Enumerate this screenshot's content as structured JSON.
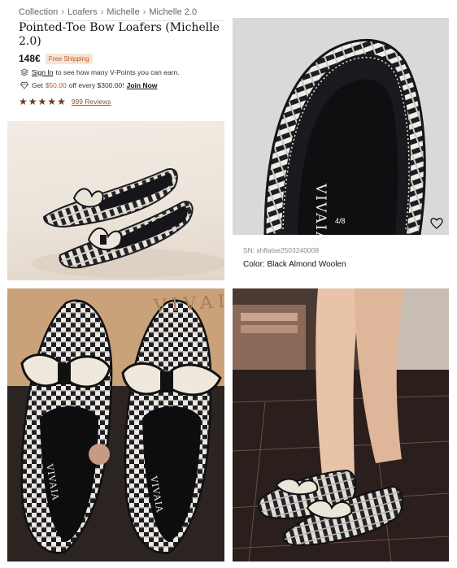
{
  "breadcrumb": {
    "items": [
      "Collection",
      "Loafers",
      "Michelle",
      "Michelle 2.0"
    ],
    "separator": "›"
  },
  "product": {
    "title": "Pointed-Toe Bow Loafers (Michelle 2.0)",
    "price": "148€",
    "shipping_badge": "Free Shipping",
    "signin": {
      "link": "Sign In",
      "text": "to see how many V-Points you can earn."
    },
    "offer": {
      "get": "Get",
      "amount": "$50.00",
      "rest": "off every $300.00!",
      "join": "Join Now"
    },
    "rating": {
      "stars": 5,
      "reviews": "999 Reviews"
    },
    "sn": "SN: shflatse2503240008",
    "color": "Color: Black Almond Woolen"
  },
  "gallery": {
    "counter": "4/8",
    "brand_text": "VIVAIA",
    "box_text": "VIVAIA"
  },
  "colors": {
    "accent": "#b85a2a",
    "star": "#6a3b1c",
    "badge_bg": "#f7e4d6"
  },
  "icons": [
    "stack-icon",
    "diamond-icon",
    "star-icon",
    "heart-icon"
  ]
}
